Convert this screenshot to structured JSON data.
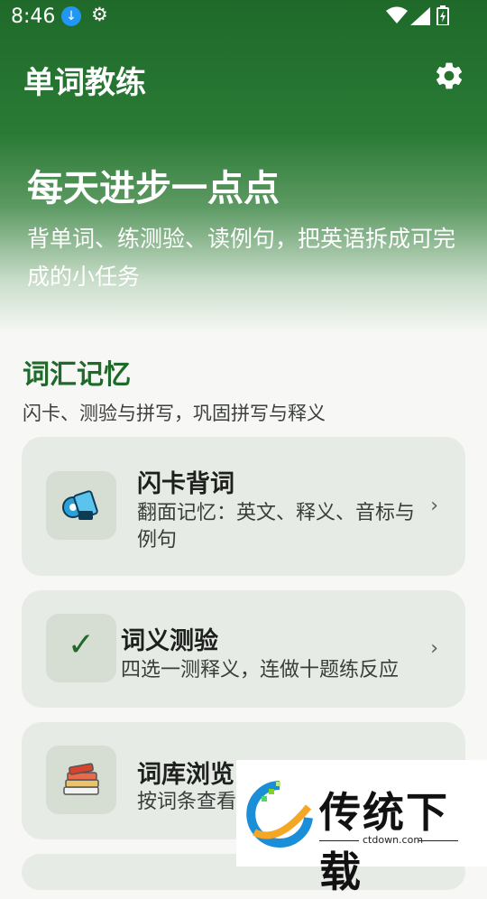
{
  "status_bar": {
    "time": "8:46"
  },
  "app": {
    "title": "单词教练"
  },
  "hero": {
    "title": "每天进步一点点",
    "subtitle": "背单词、练测验、读例句，把英语拆成可完成的小任务"
  },
  "section": {
    "title": "词汇记忆",
    "subtitle": "闪卡、测验与拼写，巩固拼写与释义"
  },
  "cards": [
    {
      "title": "闪卡背词",
      "desc": "翻面记忆：英文、释义、音标与例句",
      "icon": "flashcard-icon",
      "chevron": "›"
    },
    {
      "title": "词义测验",
      "desc": "四选一测释义，连做十题练反应",
      "icon": "check-mark-icon",
      "glyph": "✓",
      "chevron": "›"
    },
    {
      "title": "词库浏览",
      "desc": "按词条查看",
      "icon": "books-icon",
      "chevron": "›"
    }
  ],
  "watermark": {
    "text": "传统下载",
    "sub": "ctdown.com"
  },
  "colors": {
    "primary": "#1f6a2a",
    "card_bg": "#e7ebe5",
    "icon_bg": "#d6ddd3"
  }
}
